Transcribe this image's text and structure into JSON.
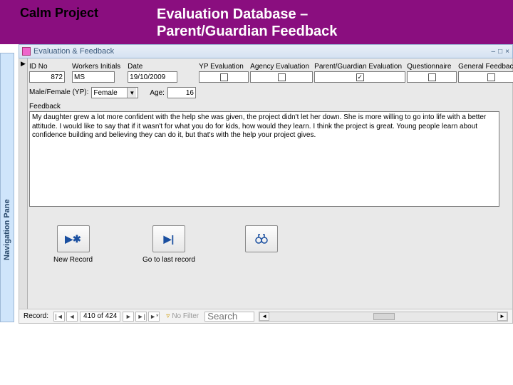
{
  "header": {
    "left": "Calm Project",
    "right_line1": "Evaluation Database –",
    "right_line2": "Parent/Guardian Feedback"
  },
  "nav_pane": {
    "label": "Navigation Pane"
  },
  "window": {
    "title": "Evaluation & Feedback",
    "min": "–",
    "max": "□",
    "close": "×"
  },
  "form": {
    "id_label": "ID No",
    "id_value": "872",
    "workers_initials_label": "Workers Initials",
    "workers_initials_value": "MS",
    "date_label": "Date",
    "date_value": "19/10/2009",
    "eval_cols": {
      "yp": "YP Evaluation",
      "agency": "Agency Evaluation",
      "parent": "Parent/Guardian Evaluation",
      "questionnaire": "Questionnaire",
      "general": "General Feedback"
    },
    "checks": {
      "yp": "",
      "agency": "",
      "parent": "✓",
      "questionnaire": "",
      "general": ""
    },
    "mf_label": "Male/Female (YP):",
    "mf_value": "Female",
    "age_label": "Age:",
    "age_value": "16",
    "feedback_label": "Feedback",
    "feedback_text": "My daughter grew a lot more confident with the help she was given, the project didn't let her down. She is more willing to go into life with a better attitude. I would like to say that if it wasn't for what you do for kids, how would they learn. I think the project is great. Young people learn about confidence building and believing they can do it, but that's with the help your project gives."
  },
  "buttons": {
    "new_record": "New Record",
    "go_last": "Go to last record",
    "find": ""
  },
  "recordnav": {
    "label": "Record:",
    "first": "|◄",
    "prev": "◄",
    "position": "410 of 424",
    "next": "►",
    "last": "►|",
    "new": "►*",
    "filter": "No Filter",
    "search_placeholder": "Search"
  }
}
